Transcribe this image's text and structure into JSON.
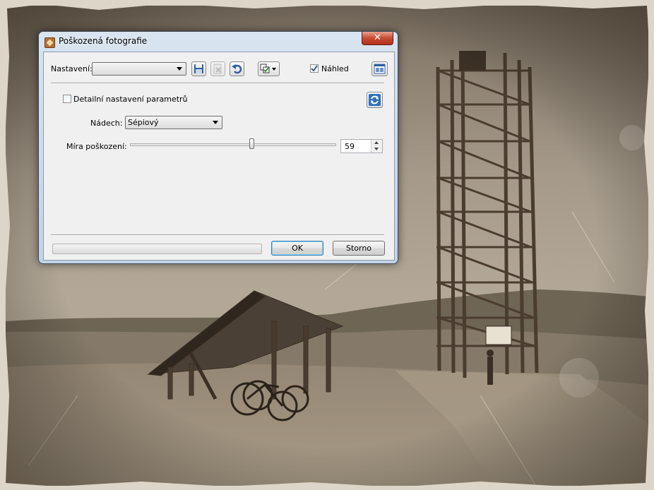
{
  "dialog": {
    "title": "Poškozená fotografie",
    "close_label": "✕"
  },
  "toolbar": {
    "preset_label": "Nastavení:",
    "preset_value": "",
    "preview_label": "Náhled",
    "preview_checked": true
  },
  "params": {
    "detail_label": "Detailní nastavení parametrů",
    "detail_checked": false,
    "tint_label": "Nádech:",
    "tint_value": "Sépiový",
    "damage_label": "Míra poškození:",
    "damage_value": "59",
    "damage_fraction": 0.59
  },
  "footer": {
    "progress": 0,
    "ok_label": "OK",
    "cancel_label": "Storno"
  },
  "colors": {
    "sepia_sky": "#a79c8d",
    "sepia_ground": "#8c7e6c",
    "accent_blue": "#3c7fb1"
  }
}
